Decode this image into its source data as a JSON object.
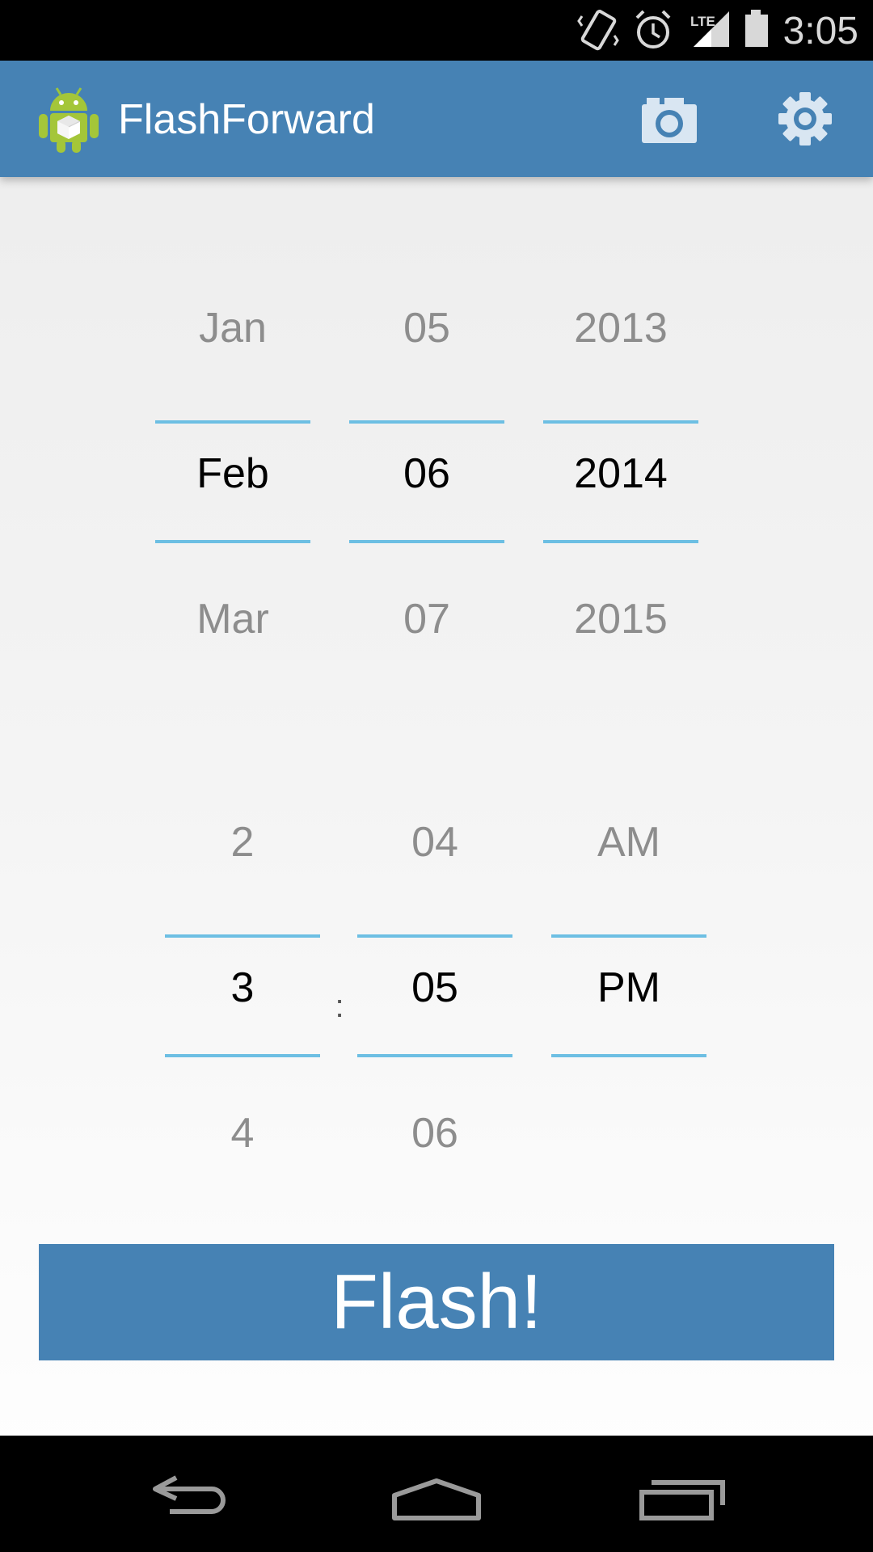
{
  "status_bar": {
    "time": "3:05",
    "icons": [
      "vibrate-icon",
      "alarm-icon",
      "lte-signal-icon",
      "battery-icon"
    ],
    "lte_label": "LTE"
  },
  "action_bar": {
    "title": "FlashForward",
    "color": "#4682b4",
    "icons": [
      "android-app-icon",
      "camera-icon",
      "settings-gear-icon"
    ]
  },
  "date_picker": {
    "month": {
      "prev": "Jan",
      "current": "Feb",
      "next": "Mar"
    },
    "day": {
      "prev": "05",
      "current": "06",
      "next": "07"
    },
    "year": {
      "prev": "2013",
      "current": "2014",
      "next": "2015"
    }
  },
  "time_picker": {
    "hour": {
      "prev": "2",
      "current": "3",
      "next": "4"
    },
    "separator": ":",
    "minute": {
      "prev": "04",
      "current": "05",
      "next": "06"
    },
    "ampm": {
      "prev": "AM",
      "current": "PM",
      "next": ""
    }
  },
  "flash_button": {
    "label": "Flash!"
  },
  "nav_bar": {
    "icons": [
      "back-icon",
      "home-icon",
      "recents-icon"
    ]
  },
  "colors": {
    "accent": "#4682b4",
    "divider": "#6dbfe3",
    "faded_text": "#8d8d8d"
  }
}
